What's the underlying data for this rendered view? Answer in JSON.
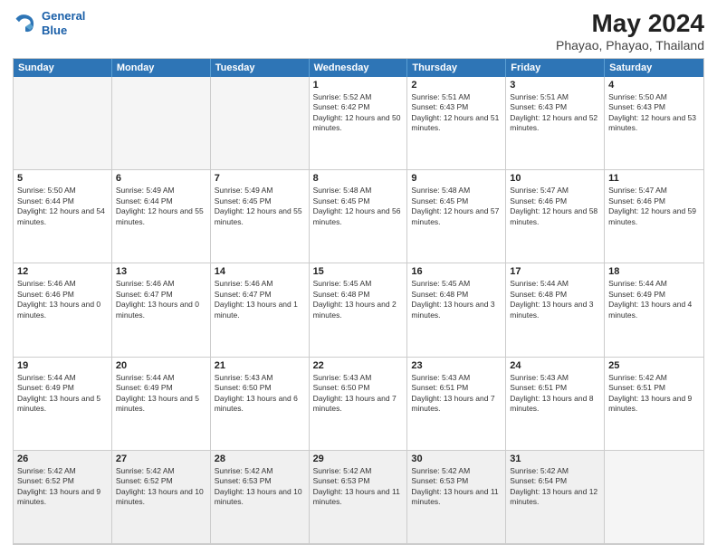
{
  "app": {
    "logo_line1": "General",
    "logo_line2": "Blue"
  },
  "title": "May 2024",
  "subtitle": "Phayao, Phayao, Thailand",
  "header": {
    "days": [
      "Sunday",
      "Monday",
      "Tuesday",
      "Wednesday",
      "Thursday",
      "Friday",
      "Saturday"
    ]
  },
  "weeks": [
    [
      {
        "day": "",
        "empty": true
      },
      {
        "day": "",
        "empty": true
      },
      {
        "day": "",
        "empty": true
      },
      {
        "day": "1",
        "sunrise": "5:52 AM",
        "sunset": "6:42 PM",
        "daylight": "12 hours and 50 minutes."
      },
      {
        "day": "2",
        "sunrise": "5:51 AM",
        "sunset": "6:43 PM",
        "daylight": "12 hours and 51 minutes."
      },
      {
        "day": "3",
        "sunrise": "5:51 AM",
        "sunset": "6:43 PM",
        "daylight": "12 hours and 52 minutes."
      },
      {
        "day": "4",
        "sunrise": "5:50 AM",
        "sunset": "6:43 PM",
        "daylight": "12 hours and 53 minutes."
      }
    ],
    [
      {
        "day": "5",
        "sunrise": "5:50 AM",
        "sunset": "6:44 PM",
        "daylight": "12 hours and 54 minutes."
      },
      {
        "day": "6",
        "sunrise": "5:49 AM",
        "sunset": "6:44 PM",
        "daylight": "12 hours and 55 minutes."
      },
      {
        "day": "7",
        "sunrise": "5:49 AM",
        "sunset": "6:45 PM",
        "daylight": "12 hours and 55 minutes."
      },
      {
        "day": "8",
        "sunrise": "5:48 AM",
        "sunset": "6:45 PM",
        "daylight": "12 hours and 56 minutes."
      },
      {
        "day": "9",
        "sunrise": "5:48 AM",
        "sunset": "6:45 PM",
        "daylight": "12 hours and 57 minutes."
      },
      {
        "day": "10",
        "sunrise": "5:47 AM",
        "sunset": "6:46 PM",
        "daylight": "12 hours and 58 minutes."
      },
      {
        "day": "11",
        "sunrise": "5:47 AM",
        "sunset": "6:46 PM",
        "daylight": "12 hours and 59 minutes."
      }
    ],
    [
      {
        "day": "12",
        "sunrise": "5:46 AM",
        "sunset": "6:46 PM",
        "daylight": "13 hours and 0 minutes."
      },
      {
        "day": "13",
        "sunrise": "5:46 AM",
        "sunset": "6:47 PM",
        "daylight": "13 hours and 0 minutes."
      },
      {
        "day": "14",
        "sunrise": "5:46 AM",
        "sunset": "6:47 PM",
        "daylight": "13 hours and 1 minute."
      },
      {
        "day": "15",
        "sunrise": "5:45 AM",
        "sunset": "6:48 PM",
        "daylight": "13 hours and 2 minutes."
      },
      {
        "day": "16",
        "sunrise": "5:45 AM",
        "sunset": "6:48 PM",
        "daylight": "13 hours and 3 minutes."
      },
      {
        "day": "17",
        "sunrise": "5:44 AM",
        "sunset": "6:48 PM",
        "daylight": "13 hours and 3 minutes."
      },
      {
        "day": "18",
        "sunrise": "5:44 AM",
        "sunset": "6:49 PM",
        "daylight": "13 hours and 4 minutes."
      }
    ],
    [
      {
        "day": "19",
        "sunrise": "5:44 AM",
        "sunset": "6:49 PM",
        "daylight": "13 hours and 5 minutes."
      },
      {
        "day": "20",
        "sunrise": "5:44 AM",
        "sunset": "6:49 PM",
        "daylight": "13 hours and 5 minutes."
      },
      {
        "day": "21",
        "sunrise": "5:43 AM",
        "sunset": "6:50 PM",
        "daylight": "13 hours and 6 minutes."
      },
      {
        "day": "22",
        "sunrise": "5:43 AM",
        "sunset": "6:50 PM",
        "daylight": "13 hours and 7 minutes."
      },
      {
        "day": "23",
        "sunrise": "5:43 AM",
        "sunset": "6:51 PM",
        "daylight": "13 hours and 7 minutes."
      },
      {
        "day": "24",
        "sunrise": "5:43 AM",
        "sunset": "6:51 PM",
        "daylight": "13 hours and 8 minutes."
      },
      {
        "day": "25",
        "sunrise": "5:42 AM",
        "sunset": "6:51 PM",
        "daylight": "13 hours and 9 minutes."
      }
    ],
    [
      {
        "day": "26",
        "sunrise": "5:42 AM",
        "sunset": "6:52 PM",
        "daylight": "13 hours and 9 minutes."
      },
      {
        "day": "27",
        "sunrise": "5:42 AM",
        "sunset": "6:52 PM",
        "daylight": "13 hours and 10 minutes."
      },
      {
        "day": "28",
        "sunrise": "5:42 AM",
        "sunset": "6:53 PM",
        "daylight": "13 hours and 10 minutes."
      },
      {
        "day": "29",
        "sunrise": "5:42 AM",
        "sunset": "6:53 PM",
        "daylight": "13 hours and 11 minutes."
      },
      {
        "day": "30",
        "sunrise": "5:42 AM",
        "sunset": "6:53 PM",
        "daylight": "13 hours and 11 minutes."
      },
      {
        "day": "31",
        "sunrise": "5:42 AM",
        "sunset": "6:54 PM",
        "daylight": "13 hours and 12 minutes."
      },
      {
        "day": "",
        "empty": true
      }
    ]
  ]
}
